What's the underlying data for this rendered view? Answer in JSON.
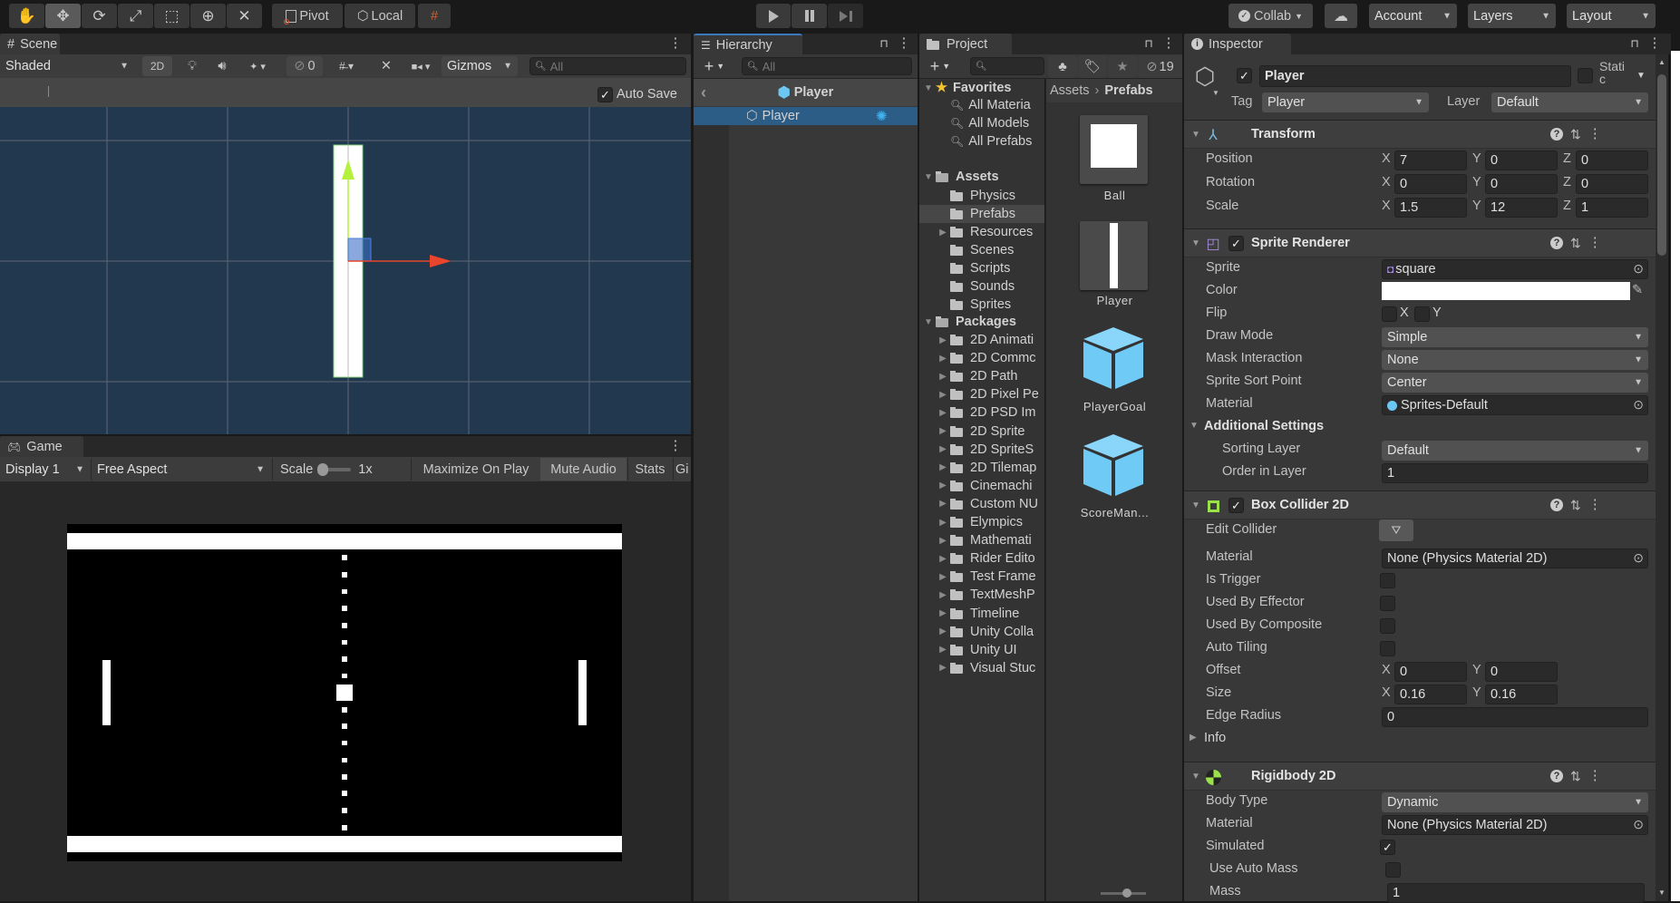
{
  "toolbar": {
    "tools": [
      "hand-tool",
      "move-tool",
      "rotate-tool",
      "scale-tool",
      "rect-tool",
      "transform-tool",
      "custom-tool"
    ],
    "pivot_label": "Pivot",
    "local_label": "Local",
    "collab_label": "Collab",
    "account_label": "Account",
    "layers_label": "Layers",
    "layout_label": "Layout"
  },
  "scene": {
    "tab_label": "Scene",
    "shading": "Shaded",
    "mode_2d": "2D",
    "hidden_count": "0",
    "gizmos_label": "Gizmos",
    "search_placeholder": "All",
    "auto_save_label": "Auto Save",
    "auto_save_checked": true,
    "background_color": "#22384f",
    "x_axis_color": "#e8452c",
    "y_axis_color": "#b4f03c"
  },
  "game": {
    "tab_label": "Game",
    "display": "Display 1",
    "aspect": "Free Aspect",
    "scale_label": "Scale",
    "scale_value": "1x",
    "maximize_label": "Maximize On Play",
    "mute_label": "Mute Audio",
    "stats_label": "Stats",
    "gizmos_label": "Gi"
  },
  "hierarchy": {
    "tab_label": "Hierarchy",
    "search_placeholder": "All",
    "prefab_root": "Player",
    "selected_item": "Player",
    "selection_color": "#2c5d87"
  },
  "project": {
    "tab_label": "Project",
    "hidden_packages_count": "19",
    "favorites": {
      "label": "Favorites",
      "items": [
        "All Materia",
        "All Models",
        "All Prefabs"
      ]
    },
    "assets": {
      "label": "Assets",
      "items": [
        {
          "label": "Physics",
          "expandable": false
        },
        {
          "label": "Prefabs",
          "expandable": false,
          "selected": true
        },
        {
          "label": "Resources",
          "expandable": true
        },
        {
          "label": "Scenes",
          "expandable": false
        },
        {
          "label": "Scripts",
          "expandable": false
        },
        {
          "label": "Sounds",
          "expandable": false
        },
        {
          "label": "Sprites",
          "expandable": false
        }
      ]
    },
    "packages": {
      "label": "Packages",
      "items": [
        "2D Animati",
        "2D Commc",
        "2D Path",
        "2D Pixel Pe",
        "2D PSD Im",
        "2D Sprite",
        "2D SpriteS",
        "2D Tilemap",
        "Cinemachi",
        "Custom NU",
        "Elympics",
        "Mathemati",
        "Rider Edito",
        "Test Frame",
        "TextMeshP",
        "Timeline",
        "Unity Colla",
        "Unity UI",
        "Visual Stuc"
      ]
    },
    "breadcrumb": [
      "Assets",
      "Prefabs"
    ],
    "grid": [
      {
        "label": "Ball",
        "icon": "sprite-square"
      },
      {
        "label": "Player",
        "icon": "sprite-paddle"
      },
      {
        "label": "PlayerGoal",
        "icon": "prefab-cube"
      },
      {
        "label": "ScoreMan...",
        "icon": "prefab-cube"
      }
    ]
  },
  "inspector": {
    "tab_label": "Inspector",
    "object_name": "Player",
    "active": true,
    "static_label": "Stati c",
    "static_checked": false,
    "tag_label": "Tag",
    "tag": "Player",
    "layer_label": "Layer",
    "layer": "Default",
    "components": [
      {
        "title": "Transform",
        "icon": "transform-icon",
        "has_toggle": false,
        "rows": [
          {
            "label": "Position",
            "type": "vec3",
            "x": "7",
            "y": "0",
            "z": "0"
          },
          {
            "label": "Rotation",
            "type": "vec3",
            "x": "0",
            "y": "0",
            "z": "0"
          },
          {
            "label": "Scale",
            "type": "vec3",
            "x": "1.5",
            "y": "12",
            "z": "1"
          }
        ]
      },
      {
        "title": "Sprite Renderer",
        "icon": "sprite-renderer-icon",
        "has_toggle": true,
        "enabled": true,
        "rows": [
          {
            "label": "Sprite",
            "type": "object",
            "value": "square",
            "icon": "sprite-icon"
          },
          {
            "label": "Color",
            "type": "color",
            "value": "#ffffff"
          },
          {
            "label": "Flip",
            "type": "flip",
            "x_label": "X",
            "y_label": "Y",
            "x": false,
            "y": false
          },
          {
            "label": "Draw Mode",
            "type": "dropdown",
            "value": "Simple"
          },
          {
            "label": "Mask Interaction",
            "type": "dropdown",
            "value": "None"
          },
          {
            "label": "Sprite Sort Point",
            "type": "dropdown",
            "value": "Center"
          },
          {
            "label": "Material",
            "type": "object",
            "value": "Sprites-Default",
            "icon": "material-icon"
          },
          {
            "label": "Additional Settings",
            "type": "foldout"
          },
          {
            "label": "Sorting Layer",
            "type": "dropdown",
            "value": "Default",
            "indent": true
          },
          {
            "label": "Order in Layer",
            "type": "text",
            "value": "1",
            "indent": true
          }
        ]
      },
      {
        "title": "Box Collider 2D",
        "icon": "box-collider-icon",
        "has_toggle": true,
        "enabled": true,
        "rows": [
          {
            "label": "Edit Collider",
            "type": "button",
            "tall": true
          },
          {
            "label": "Material",
            "type": "object",
            "value": "None (Physics Material 2D)"
          },
          {
            "label": "Is Trigger",
            "type": "checkbox",
            "value": false
          },
          {
            "label": "Used By Effector",
            "type": "checkbox",
            "value": false
          },
          {
            "label": "Used By Composite",
            "type": "checkbox",
            "value": false
          },
          {
            "label": "Auto Tiling",
            "type": "checkbox",
            "value": false
          },
          {
            "label": "Offset",
            "type": "vec2",
            "x": "0",
            "y": "0"
          },
          {
            "label": "Size",
            "type": "vec2",
            "x": "0.16",
            "y": "0.16"
          },
          {
            "label": "Edge Radius",
            "type": "text",
            "value": "0"
          },
          {
            "label": "Info",
            "type": "foldout-closed"
          }
        ]
      },
      {
        "title": "Rigidbody 2D",
        "icon": "rigidbody-icon",
        "has_toggle": false,
        "rows": [
          {
            "label": "Body Type",
            "type": "dropdown",
            "value": "Dynamic"
          },
          {
            "label": "Material",
            "type": "object",
            "value": "None (Physics Material 2D)"
          },
          {
            "label": "Simulated",
            "type": "checkbox",
            "value": true
          },
          {
            "label": "Use Auto Mass",
            "type": "checkbox",
            "value": false,
            "indent_small": true
          },
          {
            "label": "Mass",
            "type": "text",
            "value": "1",
            "indent_small": true
          }
        ]
      }
    ]
  }
}
